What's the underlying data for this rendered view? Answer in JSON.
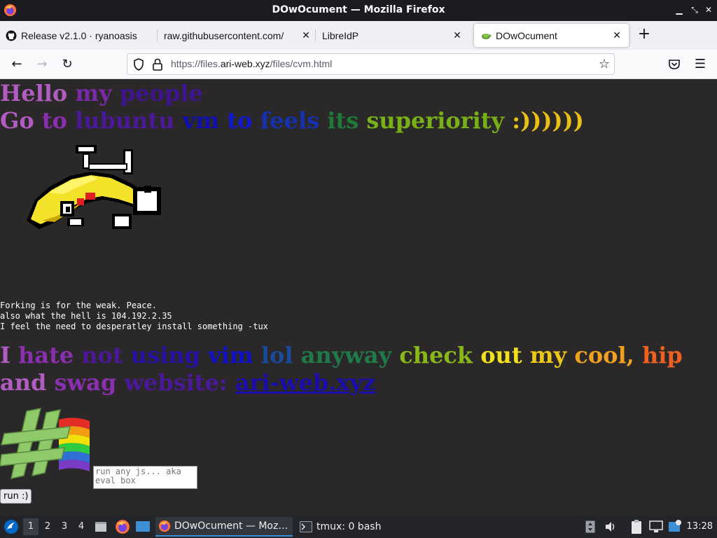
{
  "window": {
    "title": "DOwOcument — Mozilla Firefox"
  },
  "tabs": [
    {
      "label": "Release v2.1.0 · ryanoasis",
      "icon": "github-icon"
    },
    {
      "label": "raw.githubusercontent.com/",
      "icon": "none"
    },
    {
      "label": "LibreIdP",
      "icon": "none"
    },
    {
      "label": "DOwOcument",
      "icon": "turtle-icon",
      "active": true
    }
  ],
  "navbar": {
    "url_prefix": "https://files.",
    "url_host": "ari-web.xyz",
    "url_path": "/files/cvm.html"
  },
  "page": {
    "line1": [
      "Hello",
      "my",
      "people"
    ],
    "line2": [
      "Go",
      "to",
      "lubuntu",
      "vm",
      "to",
      "feels",
      "its",
      "superiority",
      ":))))))"
    ],
    "mono_lines": [
      "Forking is for the weak. Peace.",
      "also what the hell is 104.192.2.35",
      "I feel the need to desperatley install something -tux"
    ],
    "line3": [
      "I",
      "hate",
      "not",
      "using",
      "vim",
      "lol",
      "anyway",
      "check",
      "out",
      "my",
      "cool,",
      "hip"
    ],
    "line4": [
      "and",
      "swag",
      "website:"
    ],
    "link": "ari-web.xyz",
    "eval_placeholder": "run any js... aka eval box",
    "run_label": "run :)"
  },
  "colors": {
    "rainbow": [
      "#b05cc0",
      "#8a2fb0",
      "#5a1aa0",
      "#3010a0",
      "#1810c0",
      "#1010d0",
      "#1530c0",
      "#1c5a9a",
      "#1f7a4a",
      "#2a8a25",
      "#58a018",
      "#a0c016",
      "#d8cc10",
      "#e8c016",
      "#eca020",
      "#f07a20",
      "#f05020"
    ],
    "page_bg": "#2a2828",
    "titlebar_bg": "#1c1b22",
    "taskbar_bg": "#23252a"
  },
  "taskbar": {
    "workspaces": [
      "1",
      "2",
      "3",
      "4"
    ],
    "tasks": [
      {
        "label": "DOwOcument — Moz…",
        "icon": "firefox-icon",
        "active": true
      },
      {
        "label": "tmux: 0 bash",
        "icon": "terminal-icon",
        "active": false
      }
    ],
    "clock": "13:28"
  }
}
